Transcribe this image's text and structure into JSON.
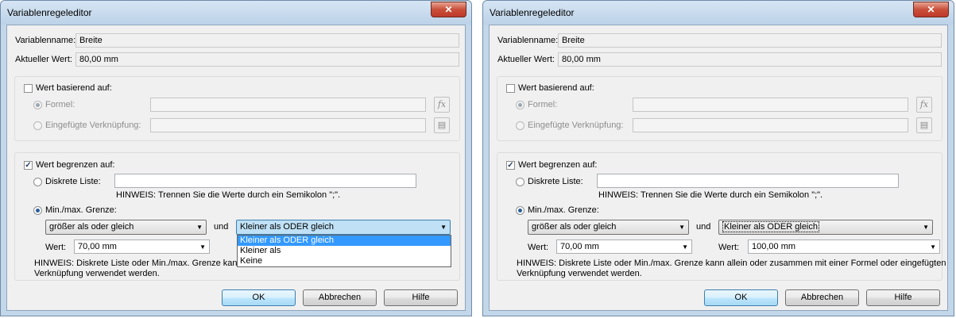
{
  "left": {
    "title": "Variablenregeleditor",
    "close": "✕",
    "name_label": "Variablenname:",
    "name_value": "Breite",
    "current_label": "Aktueller Wert:",
    "current_value": "80,00 mm",
    "based_on_label": "Wert basierend auf:",
    "formula_label": "Formel:",
    "link_label": "Eingefügte Verknüpfung:",
    "limit_label": "Wert begrenzen auf:",
    "discrete_label": "Diskrete Liste:",
    "discrete_hint": "HINWEIS: Trennen Sie die Werte durch ein Semikolon \";\".",
    "minmax_label": "Min./max. Grenze:",
    "lower_op": "größer als oder gleich",
    "and_label": "und",
    "upper_op": "Kleiner als ODER gleich",
    "wert1_label": "Wert:",
    "wert1_value": "70,00 mm",
    "hint_partial_1": "HINWEIS: Diskrete Liste oder Min./max. Grenze kann",
    "hint_partial_2": "Verknüpfung verwendet werden.",
    "dropdown_options": [
      "Kleiner als ODER gleich",
      "Kleiner als",
      "Keine"
    ],
    "ok": "OK",
    "cancel": "Abbrechen",
    "help": "Hilfe"
  },
  "right": {
    "title": "Variablenregeleditor",
    "close": "✕",
    "name_label": "Variablenname:",
    "name_value": "Breite",
    "current_label": "Aktueller Wert:",
    "current_value": "80,00 mm",
    "based_on_label": "Wert basierend auf:",
    "formula_label": "Formel:",
    "link_label": "Eingefügte Verknüpfung:",
    "limit_label": "Wert begrenzen auf:",
    "discrete_label": "Diskrete Liste:",
    "discrete_hint": "HINWEIS: Trennen Sie die Werte durch ein Semikolon \";\".",
    "minmax_label": "Min./max. Grenze:",
    "lower_op": "größer als oder gleich",
    "and_label": "und",
    "upper_op": "Kleiner als ODER gleich",
    "wert1_label": "Wert:",
    "wert1_value": "70,00 mm",
    "wert2_label": "Wert:",
    "wert2_value": "100,00 mm",
    "hint_line1": "HINWEIS: Diskrete Liste oder Min./max. Grenze kann allein oder zusammen mit einer Formel oder eingefügten",
    "hint_line2": "Verknüpfung verwendet werden.",
    "ok": "OK",
    "cancel": "Abbrechen",
    "help": "Hilfe"
  }
}
